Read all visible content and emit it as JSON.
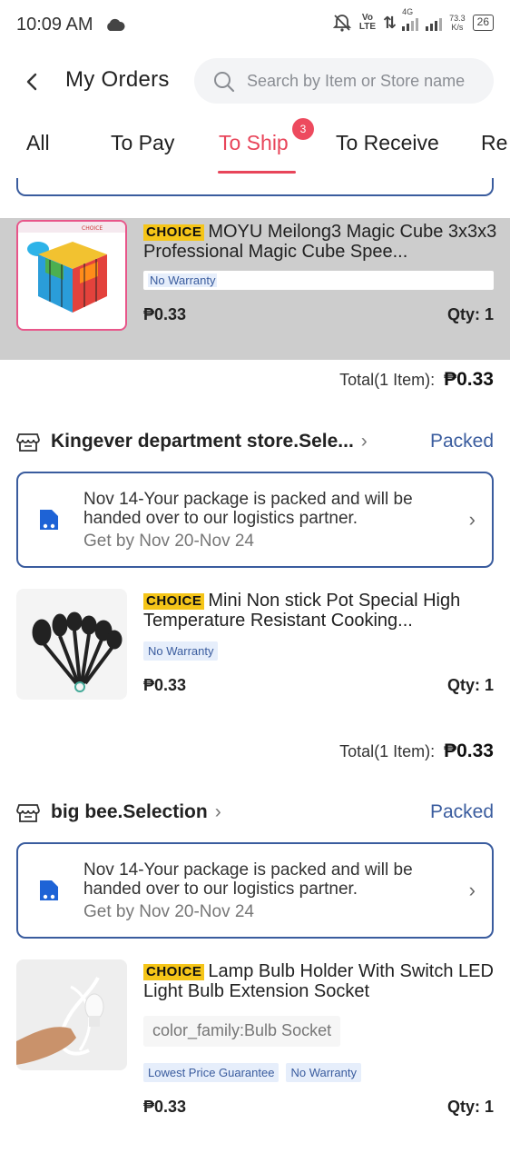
{
  "status_bar": {
    "time": "10:09 AM",
    "volte_top": "Vo",
    "volte_bottom": "LTE",
    "network": "4G",
    "speed_top": "73.3",
    "speed_bottom": "K/s",
    "battery": "26"
  },
  "header": {
    "title": "My Orders",
    "search_placeholder": "Search by Item or Store name"
  },
  "tabs": [
    {
      "label": "All"
    },
    {
      "label": "To Pay"
    },
    {
      "label": "To Ship",
      "active": true,
      "badge": "3"
    },
    {
      "label": "To Receive"
    },
    {
      "label": "Re"
    }
  ],
  "orders": [
    {
      "items": [
        {
          "choice": "CHOICE",
          "title": "MOYU Meilong3 Magic Cube 3x3x3 Professional Magic Cube Spee...",
          "tags": [
            "No Warranty"
          ],
          "price": "₱0.33",
          "qty": "Qty: 1"
        }
      ],
      "total_label": "Total(1 Item):",
      "total_value": "₱0.33"
    },
    {
      "store": "Kingever department store.Sele...",
      "status": "Packed",
      "package_message": "Nov 14-Your package is packed and will be handed over to our logistics partner.",
      "package_eta": "Get by Nov 20-Nov 24",
      "items": [
        {
          "choice": "CHOICE",
          "title": "Mini Non stick Pot Special High Temperature Resistant Cooking...",
          "tags": [
            "No Warranty"
          ],
          "price": "₱0.33",
          "qty": "Qty: 1"
        }
      ],
      "total_label": "Total(1 Item):",
      "total_value": "₱0.33"
    },
    {
      "store": "big bee.Selection",
      "status": "Packed",
      "package_message": "Nov 14-Your package is packed and will be handed over to our logistics partner.",
      "package_eta": "Get by Nov 20-Nov 24",
      "items": [
        {
          "choice": "CHOICE",
          "title": "Lamp Bulb Holder With Switch LED Light Bulb Extension Socket",
          "variant": "color_family:Bulb Socket",
          "tags": [
            "Lowest Price Guarantee",
            "No Warranty"
          ],
          "price": "₱0.33",
          "qty": "Qty: 1"
        }
      ]
    }
  ],
  "colors": {
    "accent": "#e8455a",
    "link_blue": "#3a5c9e",
    "choice_yellow": "#f5c518",
    "highlight_gray": "#cdcdcd"
  }
}
